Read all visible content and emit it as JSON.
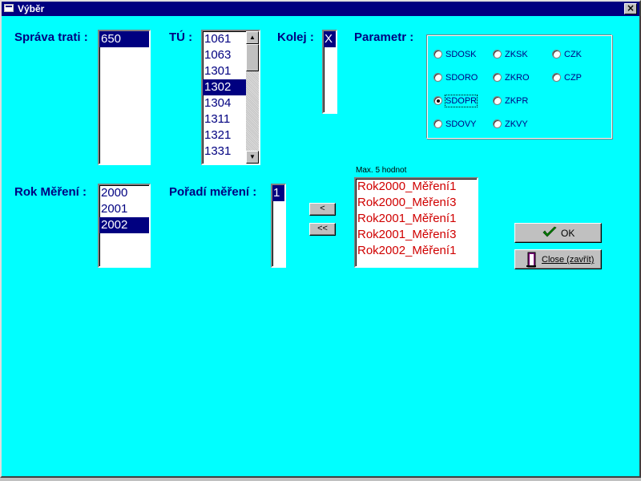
{
  "window": {
    "title": "Výběr"
  },
  "labels": {
    "sprava_trati": "Správa trati :",
    "tu": "TÚ :",
    "kolej": "Kolej :",
    "parametr": "Parametr :",
    "rok_mereni": "Rok Měření :",
    "poradi_mereni": "Pořadí měření :",
    "max_hint": "Max. 5 hodnot"
  },
  "lists": {
    "sprava_trati": {
      "items": [
        "650"
      ],
      "selected": "650"
    },
    "tu": {
      "items": [
        "1061",
        "1063",
        "1301",
        "1302",
        "1304",
        "1311",
        "1321",
        "1331"
      ],
      "selected": "1302"
    },
    "kolej": {
      "items": [
        "X"
      ],
      "selected": "X"
    },
    "rok_mereni": {
      "items": [
        "2000",
        "2001",
        "2002"
      ],
      "selected": "2002"
    },
    "poradi_mereni": {
      "items": [
        "1"
      ],
      "selected": "1"
    },
    "selected_values": {
      "items": [
        "Rok2000_Měření1",
        "Rok2000_Měření3",
        "Rok2001_Měření1",
        "Rok2001_Měření3",
        "Rok2002_Měření1"
      ]
    }
  },
  "parametr": {
    "options": [
      "SDOSK",
      "ZKSK",
      "CZK",
      "SDORO",
      "ZKRO",
      "CZP",
      "SDOPR",
      "ZKPR",
      "SDOVY",
      "ZKVY"
    ],
    "selected": "SDOPR"
  },
  "buttons": {
    "move_one": "<",
    "move_all": "<<",
    "ok": "OK",
    "close": "Close (zavřít)"
  },
  "colors": {
    "background": "#00ffff",
    "selection": "#000080",
    "label_text": "#000080",
    "selected_values_text": "#d00000"
  }
}
